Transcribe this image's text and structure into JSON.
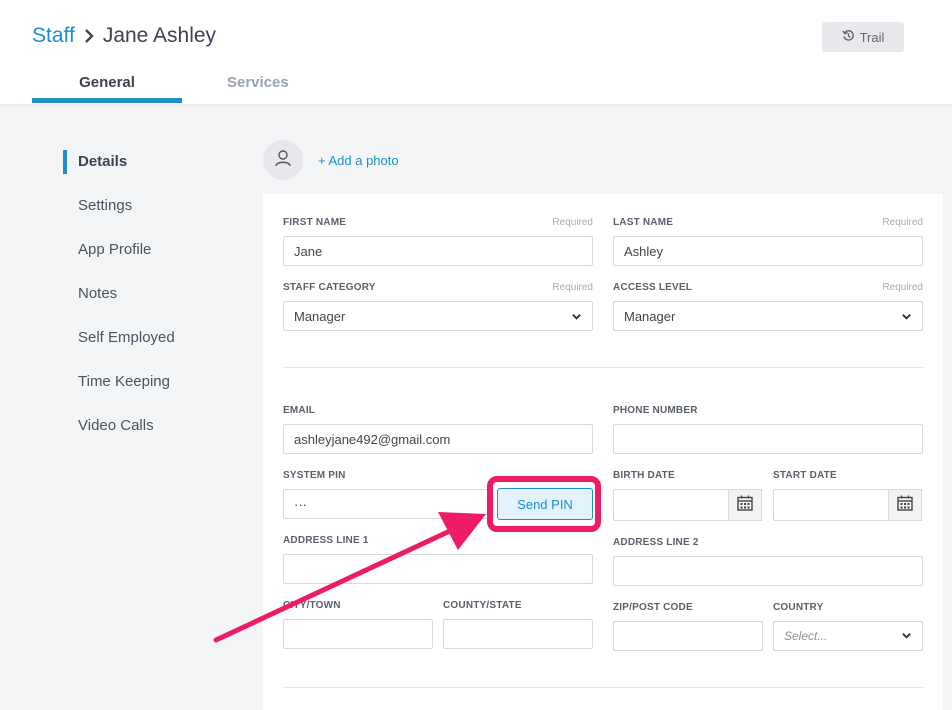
{
  "breadcrumb": {
    "root": "Staff",
    "current": "Jane Ashley"
  },
  "header": {
    "trail_label": "Trail"
  },
  "tabs": [
    {
      "label": "General"
    },
    {
      "label": "Services"
    }
  ],
  "sidebar": {
    "items": [
      {
        "label": "Details"
      },
      {
        "label": "Settings"
      },
      {
        "label": "App Profile"
      },
      {
        "label": "Notes"
      },
      {
        "label": "Self Employed"
      },
      {
        "label": "Time Keeping"
      },
      {
        "label": "Video Calls"
      }
    ]
  },
  "photo": {
    "add_label": "+ Add a photo"
  },
  "form": {
    "required_text": "Required",
    "first_name": {
      "label": "FIRST NAME",
      "value": "Jane"
    },
    "last_name": {
      "label": "LAST NAME",
      "value": "Ashley"
    },
    "staff_category": {
      "label": "STAFF CATEGORY",
      "value": "Manager"
    },
    "access_level": {
      "label": "ACCESS LEVEL",
      "value": "Manager"
    },
    "email": {
      "label": "EMAIL",
      "value": "ashleyjane492@gmail.com"
    },
    "phone": {
      "label": "PHONE NUMBER",
      "value": ""
    },
    "system_pin": {
      "label": "SYSTEM PIN",
      "value": "···"
    },
    "send_pin_label": "Send PIN",
    "birth_date": {
      "label": "BIRTH DATE",
      "value": ""
    },
    "start_date": {
      "label": "START DATE",
      "value": ""
    },
    "address1": {
      "label": "ADDRESS LINE 1",
      "value": ""
    },
    "address2": {
      "label": "ADDRESS LINE 2",
      "value": ""
    },
    "city": {
      "label": "CITY/TOWN",
      "value": ""
    },
    "county": {
      "label": "COUNTY/STATE",
      "value": ""
    },
    "zip": {
      "label": "ZIP/POST CODE",
      "value": ""
    },
    "country": {
      "label": "COUNTRY",
      "placeholder": "Select..."
    }
  },
  "colors": {
    "accent": "#1e8fc6",
    "highlight": "#ee1b66",
    "text": "#3d4450"
  }
}
